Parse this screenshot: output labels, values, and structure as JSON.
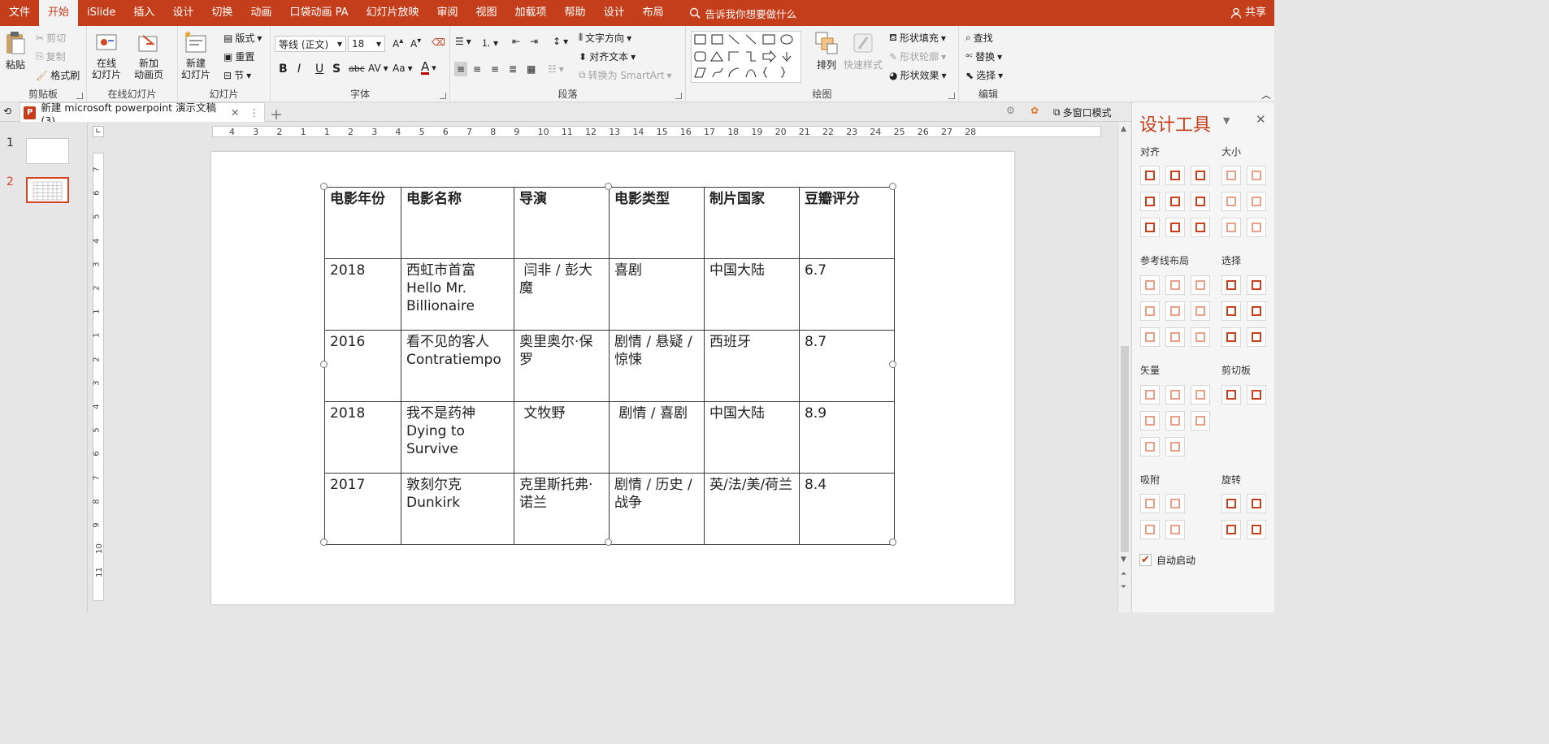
{
  "menubar": {
    "tabs": [
      {
        "label": "文件",
        "active": false
      },
      {
        "label": "开始",
        "active": true
      },
      {
        "label": "iSlide",
        "active": false
      },
      {
        "label": "插入",
        "active": false
      },
      {
        "label": "设计",
        "active": false
      },
      {
        "label": "切换",
        "active": false
      },
      {
        "label": "动画",
        "active": false
      },
      {
        "label": "口袋动画 PA",
        "active": false
      },
      {
        "label": "幻灯片放映",
        "active": false
      },
      {
        "label": "审阅",
        "active": false
      },
      {
        "label": "视图",
        "active": false
      },
      {
        "label": "加载项",
        "active": false
      },
      {
        "label": "帮助",
        "active": false
      },
      {
        "label": "设计",
        "active": false
      },
      {
        "label": "布局",
        "active": false
      }
    ],
    "search_placeholder": "告诉我你想要做什么",
    "share_label": "共享"
  },
  "ribbon": {
    "clipboard": {
      "group": "剪贴板",
      "paste": "粘贴",
      "cut": "剪切",
      "copy": "复制",
      "format_painter": "格式刷"
    },
    "online_slides": {
      "group": "在线幻灯片",
      "online": "在线\n幻灯片",
      "new_animation": "新加\n动画页"
    },
    "slides": {
      "group": "幻灯片",
      "new_slide": "新建\n幻灯片",
      "layout": "版式",
      "reset": "重置",
      "section": "节"
    },
    "font": {
      "group": "字体",
      "font_name": "等线 (正文)",
      "font_size": "18"
    },
    "paragraph": {
      "group": "段落",
      "text_direction": "文字方向",
      "align_text": "对齐文本",
      "convert_smartart": "转换为 SmartArt"
    },
    "drawing": {
      "group": "绘图",
      "arrange": "排列",
      "quick_styles": "快速样式",
      "shape_fill": "形状填充",
      "shape_outline": "形状轮廓",
      "shape_effects": "形状效果"
    },
    "editing": {
      "group": "编辑",
      "find": "查找",
      "replace": "替换",
      "select": "选择"
    }
  },
  "docbar": {
    "tab_title": "新建 microsoft powerpoint 演示文稿 (3)",
    "multiwindow": "多窗口模式"
  },
  "thumbnails": [
    {
      "num": "1",
      "selected": false
    },
    {
      "num": "2",
      "selected": true
    }
  ],
  "ruler": {
    "h_ticks": [
      "4",
      "3",
      "2",
      "1",
      "1",
      "2",
      "3",
      "4",
      "5",
      "6",
      "7",
      "8",
      "9",
      "10",
      "11",
      "12",
      "13",
      "14",
      "15",
      "16",
      "17",
      "18",
      "19",
      "20",
      "21",
      "22",
      "23",
      "24",
      "25",
      "26",
      "27",
      "28"
    ],
    "v_ticks": [
      "7",
      "6",
      "5",
      "4",
      "3",
      "2",
      "1",
      "1",
      "2",
      "3",
      "4",
      "5",
      "6",
      "7",
      "8",
      "9",
      "10",
      "11"
    ]
  },
  "table": {
    "headers": [
      "电影年份",
      "电影名称",
      "导演",
      "电影类型",
      "制片国家",
      "豆瓣评分"
    ],
    "rows": [
      [
        "2018",
        "西虹市首富\nHello Mr.\nBillionaire",
        " 闫非 / 彭大魔",
        "喜剧",
        "中国大陆",
        "6.7"
      ],
      [
        "2016",
        "看不见的客人\nContratiempo",
        "奥里奥尔·保罗",
        "剧情 / 悬疑 / 惊悚",
        "西班牙",
        "8.7"
      ],
      [
        "2018",
        "我不是药神\nDying to\nSurvive",
        " 文牧野",
        " 剧情 / 喜剧",
        "中国大陆",
        "8.9"
      ],
      [
        "2017",
        "敦刻尔克\nDunkirk",
        "克里斯托弗·诺兰",
        "剧情 / 历史 / 战争",
        "英/法/美/荷兰",
        "8.4"
      ]
    ]
  },
  "design_pane": {
    "title": "设计工具",
    "sections": {
      "align": "对齐",
      "size": "大小",
      "guide_layout": "参考线布局",
      "select": "选择",
      "vector": "矢量",
      "clipboard": "剪切板",
      "snap": "吸附",
      "rotate": "旋转"
    },
    "auto_start": "自动启动",
    "auto_start_checked": true
  },
  "colors": {
    "accent": "#c43e1c",
    "pane_icon": "#e9a08a"
  }
}
